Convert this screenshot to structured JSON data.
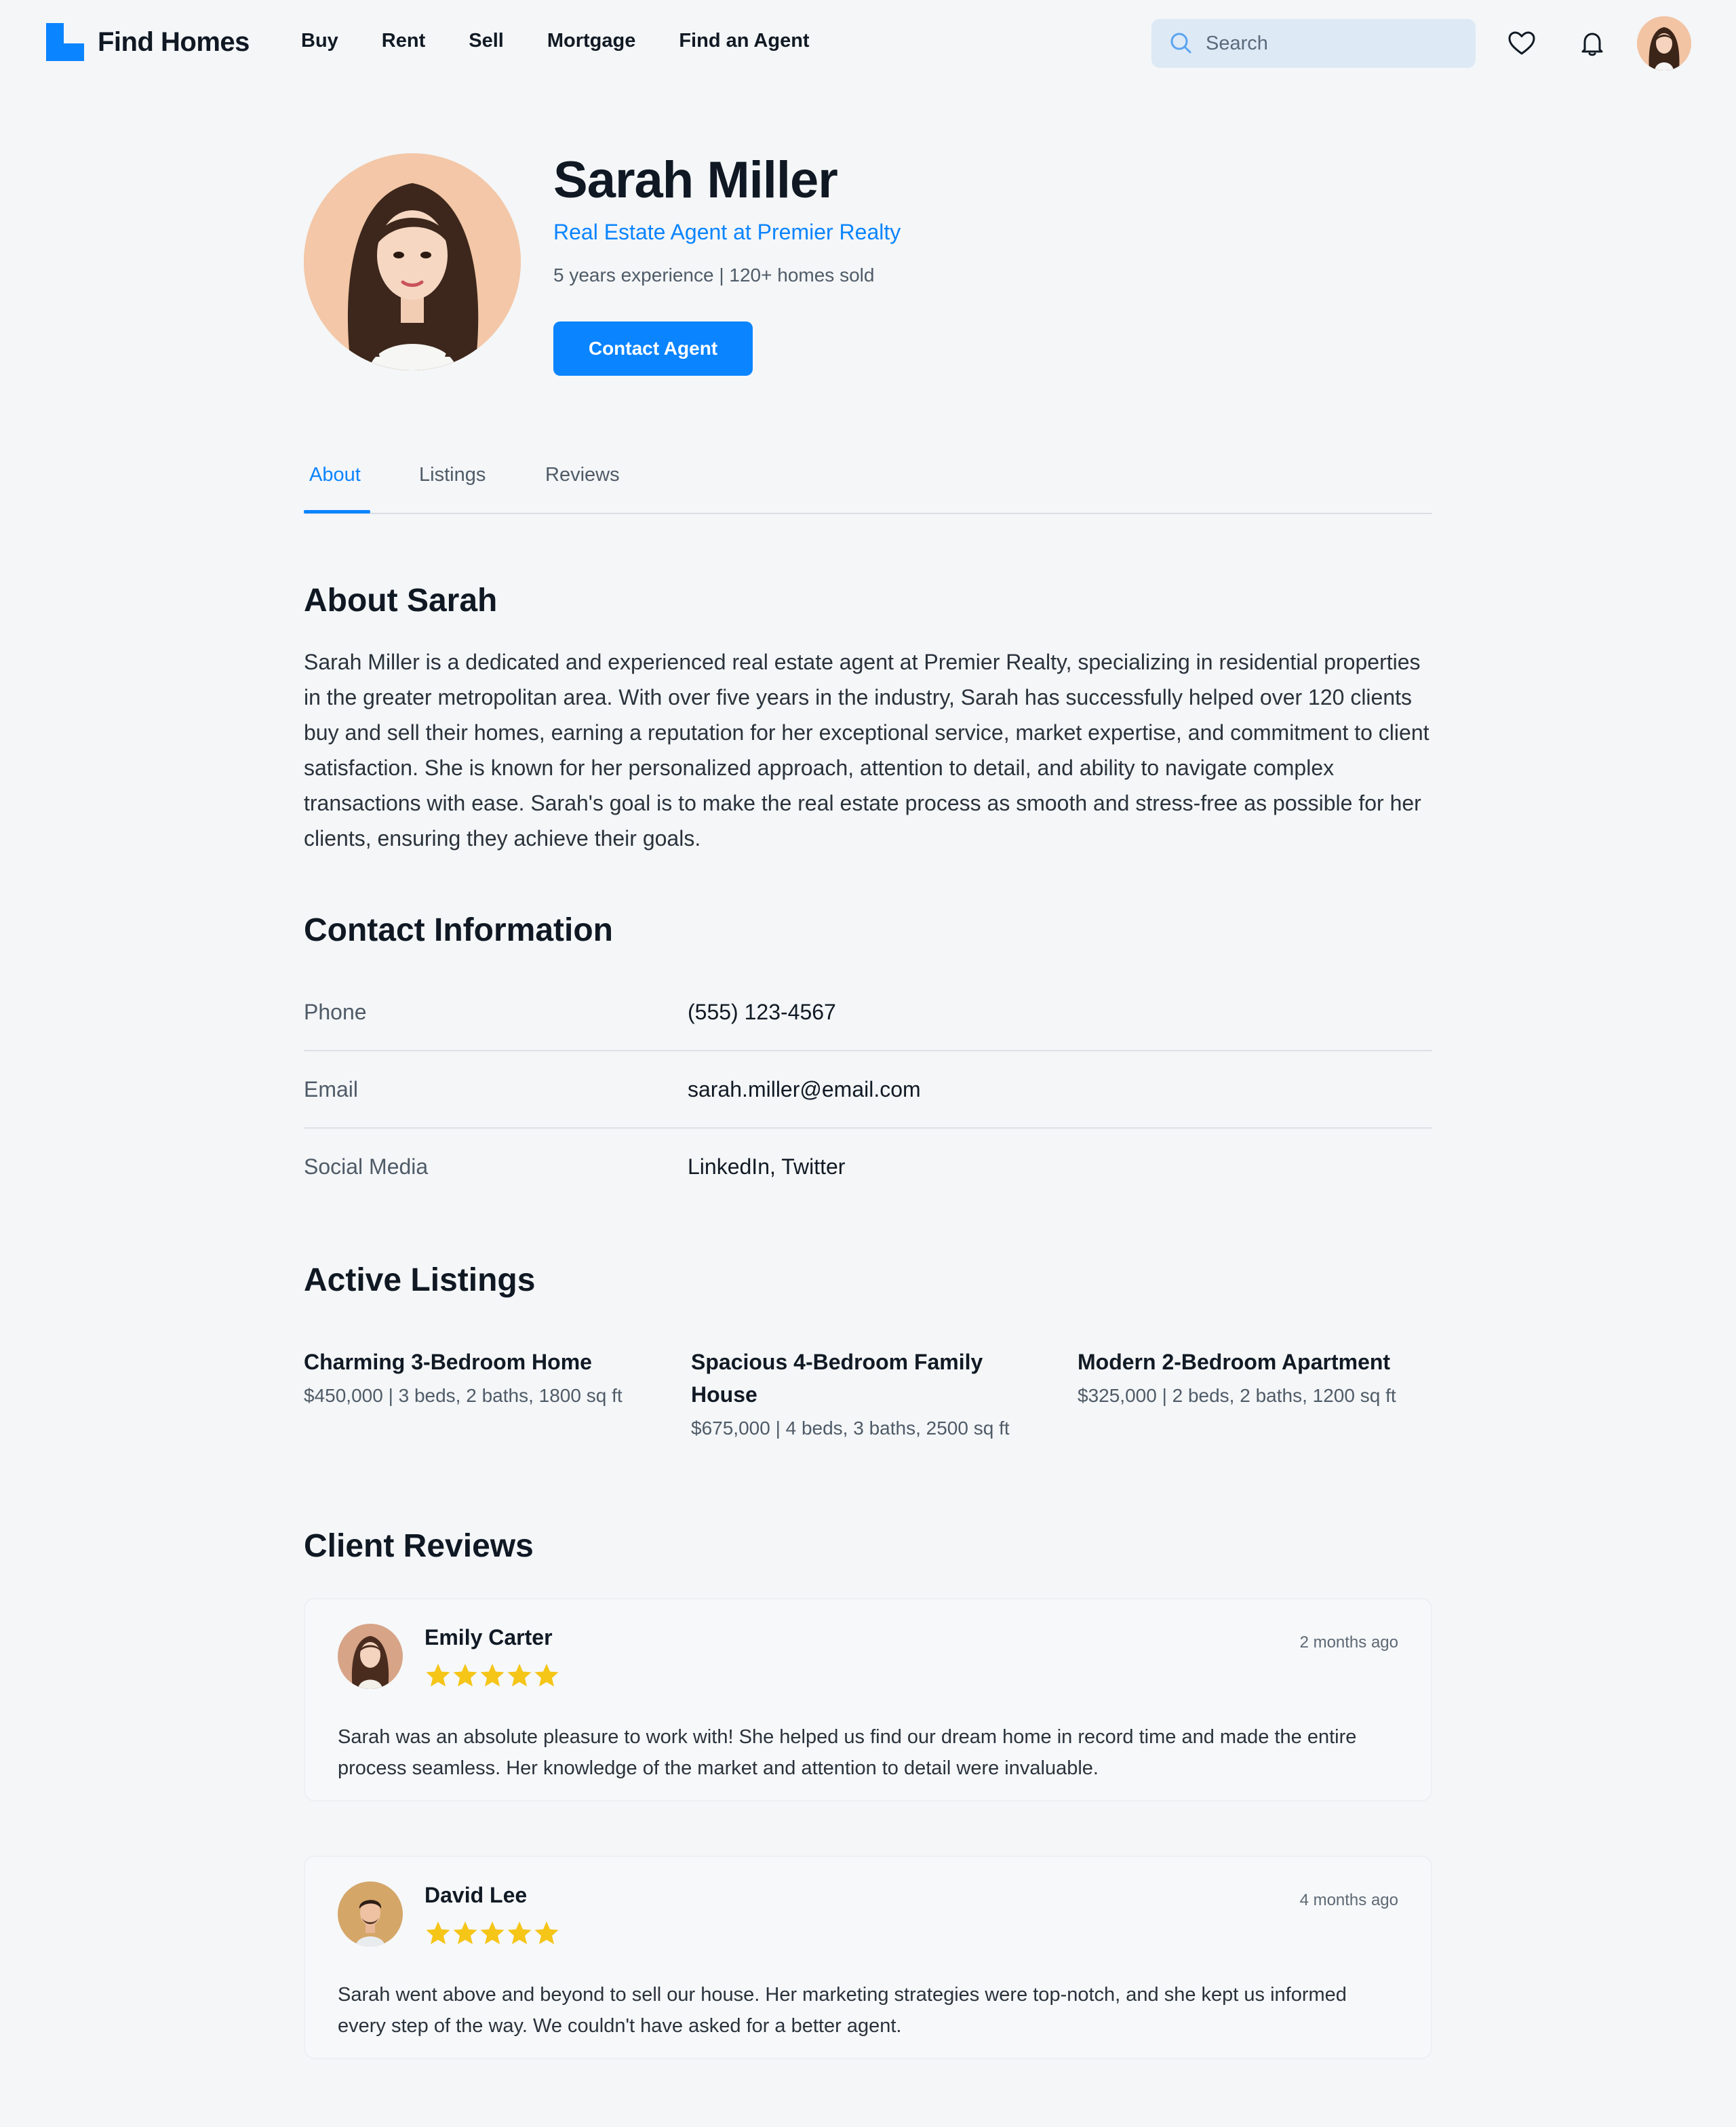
{
  "brand": {
    "name": "Find Homes",
    "accent": "#0a84ff"
  },
  "nav": [
    "Buy",
    "Rent",
    "Sell",
    "Mortgage",
    "Find an Agent"
  ],
  "search": {
    "placeholder": "Search",
    "value": ""
  },
  "header_icons": [
    "heart-icon",
    "bell-icon",
    "user-avatar"
  ],
  "profile": {
    "name": "Sarah Miller",
    "title": "Real Estate Agent at Premier Realty",
    "meta": "5 years experience | 120+ homes sold",
    "contact_button": "Contact Agent"
  },
  "tabs": [
    {
      "label": "About",
      "active": true
    },
    {
      "label": "Listings",
      "active": false
    },
    {
      "label": "Reviews",
      "active": false
    }
  ],
  "about": {
    "heading": "About Sarah",
    "text": "Sarah Miller is a dedicated and experienced real estate agent at Premier Realty, specializing in residential properties in the greater metropolitan area. With over five years in the industry, Sarah has successfully helped over 120 clients buy and sell their homes, earning a reputation for her exceptional service, market expertise, and commitment to client satisfaction. She is known for her personalized approach, attention to detail, and ability to navigate complex transactions with ease. Sarah's goal is to make the real estate process as smooth and stress-free as possible for her clients, ensuring they achieve their goals."
  },
  "contact": {
    "heading": "Contact Information",
    "rows": [
      {
        "label": "Phone",
        "value": "(555) 123-4567"
      },
      {
        "label": "Email",
        "value": "sarah.miller@email.com"
      },
      {
        "label": "Social Media",
        "value": "LinkedIn, Twitter"
      }
    ]
  },
  "listings": {
    "heading": "Active Listings",
    "items": [
      {
        "title": "Charming 3-Bedroom Home",
        "meta": "$450,000 | 3 beds, 2 baths, 1800 sq ft"
      },
      {
        "title": "Spacious 4-Bedroom Family House",
        "meta": "$675,000 | 4 beds, 3 baths, 2500 sq ft"
      },
      {
        "title": "Modern 2-Bedroom Apartment",
        "meta": "$325,000 | 2 beds, 2 baths, 1200 sq ft"
      }
    ]
  },
  "reviews": {
    "heading": "Client Reviews",
    "star_color": "#f5c518",
    "items": [
      {
        "name": "Emily Carter",
        "date": "2 months ago",
        "rating": 5,
        "text": "Sarah was an absolute pleasure to work with! She helped us find our dream home in record time and made the entire process seamless. Her knowledge of the market and attention to detail were invaluable."
      },
      {
        "name": "David Lee",
        "date": "4 months ago",
        "rating": 5,
        "text": "Sarah went above and beyond to sell our house. Her marketing strategies were top-notch, and she kept us informed every step of the way. We couldn't have asked for a better agent."
      }
    ]
  }
}
